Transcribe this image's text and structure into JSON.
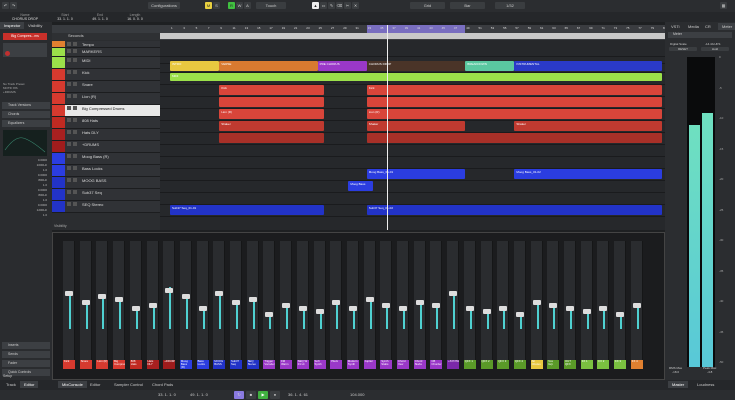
{
  "toolbar": {
    "configurations": "Configurations",
    "m": "M",
    "s": "S",
    "r": "R",
    "w": "W",
    "a": "A",
    "touch": "Touch",
    "grid": "Grid",
    "bar": "Bar",
    "quant": "1/32"
  },
  "infoline": {
    "fields": [
      {
        "label": "Name",
        "value": "CHORUS DROP"
      },
      {
        "label": "Start",
        "value": "33. 1. 1.  0"
      },
      {
        "label": "End",
        "value": "49. 1. 1.  0"
      },
      {
        "label": "Length",
        "value": "16. 0. 0.  0"
      }
    ]
  },
  "inspector": {
    "tabs": [
      "Inspector",
      "Visibility"
    ],
    "track_name": "Big Compres...ms",
    "routing": [
      "No Track Preset",
      "MOTIF 8IS",
      "+DRUMS"
    ],
    "sections": [
      "Track Versions",
      "Chords",
      "Equalizers",
      "Inserts",
      "Sends",
      "Fader",
      "Quick Controls"
    ],
    "eq_values": [
      "0.0000",
      "1000Hz",
      "1.0",
      "0.0000",
      "800Hz",
      "1.0",
      "0.0000",
      "800Hz",
      "1.0",
      "0.0000",
      "1200Hz",
      "1.0"
    ],
    "setup": "Setup"
  },
  "tracklist": {
    "header": "Seconds",
    "footer": "Visibility",
    "tracks": [
      {
        "name": "Tempo",
        "color": "#e08030"
      },
      {
        "name": "MARKERS",
        "color": "#9be04a"
      },
      {
        "name": "MIDI",
        "color": "#9be04a"
      },
      {
        "name": "Kick",
        "color": "#d63a2f"
      },
      {
        "name": "Snare",
        "color": "#d63a2f"
      },
      {
        "name": "Lion (R)",
        "color": "#d63a2f"
      },
      {
        "name": "Big Compressed Drums",
        "color": "#d63a2f",
        "selected": true
      },
      {
        "name": "808 Hats",
        "color": "#c02a22"
      },
      {
        "name": "Hats DLY",
        "color": "#a82020"
      },
      {
        "name": "+DRUMS",
        "color": "#a01c1c"
      },
      {
        "name": "Moog Bass (R)",
        "color": "#2b3de0"
      },
      {
        "name": "Bass Locks",
        "color": "#2b3de0"
      },
      {
        "name": "MOOG BASS",
        "color": "#2233c8"
      },
      {
        "name": "Sub37 Seq",
        "color": "#2233c8"
      },
      {
        "name": "SEQ Stereo",
        "color": "#2233c8"
      }
    ]
  },
  "ruler": {
    "bars": [
      "1",
      "3",
      "5",
      "7",
      "9",
      "11",
      "13",
      "15",
      "17",
      "19",
      "21",
      "23",
      "25",
      "27",
      "29",
      "31",
      "33",
      "35",
      "37",
      "39",
      "41",
      "43",
      "45",
      "47",
      "49",
      "51",
      "53",
      "55",
      "57",
      "59",
      "61",
      "63",
      "65",
      "67",
      "69",
      "71",
      "73",
      "75",
      "77",
      "79",
      "81"
    ]
  },
  "markers": [
    {
      "label": "INTRO",
      "start": 1,
      "end": 9,
      "color": "#e8c840"
    },
    {
      "label": "VERSE",
      "start": 9,
      "end": 25,
      "color": "#d87a30"
    },
    {
      "label": "PRE CHORUS",
      "start": 25,
      "end": 33,
      "color": "#9a38c8"
    },
    {
      "label": "CHORUS DROP",
      "start": 33,
      "end": 49,
      "color": "#4a3428"
    },
    {
      "label": "BREAKDOWN",
      "start": 49,
      "end": 57,
      "color": "#5ac8a0"
    },
    {
      "label": "INSTRUMENTAL",
      "start": 57,
      "end": 81,
      "color": "#2a3ac8"
    }
  ],
  "clips": [
    {
      "row": 2,
      "label": "MIDI",
      "start": 1,
      "end": 81,
      "color": "#9be04a"
    },
    {
      "row": 3,
      "label": "Kick",
      "start": 9,
      "end": 26,
      "color": "#d8453a"
    },
    {
      "row": 3,
      "label": "Kick",
      "start": 33,
      "end": 81,
      "color": "#d8453a"
    },
    {
      "row": 4,
      "label": "",
      "start": 9,
      "end": 26,
      "color": "#d8453a"
    },
    {
      "row": 4,
      "label": "",
      "start": 33,
      "end": 81,
      "color": "#d8453a"
    },
    {
      "row": 5,
      "label": "Lion (R)",
      "start": 9,
      "end": 26,
      "color": "#d8453a"
    },
    {
      "row": 5,
      "label": "Lion (R)",
      "start": 33,
      "end": 81,
      "color": "#d8453a"
    },
    {
      "row": 6,
      "label": "Shaker",
      "start": 9,
      "end": 26,
      "color": "#c03a30"
    },
    {
      "row": 6,
      "label": "Shaker",
      "start": 33,
      "end": 49,
      "color": "#c03a30"
    },
    {
      "row": 6,
      "label": "Shaker",
      "start": 57,
      "end": 81,
      "color": "#c03a30"
    },
    {
      "row": 7,
      "label": "",
      "start": 9,
      "end": 26,
      "color": "#a83028"
    },
    {
      "row": 7,
      "label": "",
      "start": 33,
      "end": 81,
      "color": "#a83028"
    },
    {
      "row": 10,
      "label": "Moog Bass_01-01",
      "start": 33,
      "end": 49,
      "color": "#2b3de0"
    },
    {
      "row": 10,
      "label": "Moog Bass_01-02",
      "start": 57,
      "end": 81,
      "color": "#2b3de0"
    },
    {
      "row": 11,
      "label": "Moog Bass",
      "start": 30,
      "end": 34,
      "color": "#2b3de0"
    },
    {
      "row": 13,
      "label": "Sub37 Seq_01-01",
      "start": 1,
      "end": 26,
      "color": "#2233c8"
    },
    {
      "row": 13,
      "label": "Sub37 Seq_01-02",
      "start": 33,
      "end": 81,
      "color": "#2233c8"
    }
  ],
  "mixer": {
    "channels": [
      {
        "name": "Kick",
        "color": "#d63a2f",
        "level": 0.55
      },
      {
        "name": "Snare",
        "color": "#d63a2f",
        "level": 0.4
      },
      {
        "name": "Lion (R)",
        "color": "#d63a2f",
        "level": 0.5
      },
      {
        "name": "Big Compresse",
        "color": "#d63a2f",
        "level": 0.45
      },
      {
        "name": "808 Hats",
        "color": "#c02a22",
        "level": 0.3
      },
      {
        "name": "Hats DLY",
        "color": "#a82020",
        "level": 0.35
      },
      {
        "name": "+DRUMS",
        "color": "#a01c1c",
        "level": 0.6
      },
      {
        "name": "Moog Bass (R)",
        "color": "#2b3de0",
        "level": 0.5
      },
      {
        "name": "Bass Locks",
        "color": "#2b3de0",
        "level": 0.3
      },
      {
        "name": "MOOG BASS",
        "color": "#2233c8",
        "level": 0.55
      },
      {
        "name": "Sub37 Seq",
        "color": "#2233c8",
        "level": 0.4
      },
      {
        "name": "SEQ Stereo",
        "color": "#2233c8",
        "level": 0.45
      },
      {
        "name": "Trigger Vocoder",
        "color": "#9a38c8",
        "level": 0.2
      },
      {
        "name": "FM Warm",
        "color": "#9a38c8",
        "level": 0.35
      },
      {
        "name": "SEQ W 01 Hi",
        "color": "#9a38c8",
        "level": 0.3
      },
      {
        "name": "Soft Synth",
        "color": "#9a38c8",
        "level": 0.25
      },
      {
        "name": "Pluck",
        "color": "#9a38c8",
        "level": 0.4
      },
      {
        "name": "Modern Synth",
        "color": "#9a38c8",
        "level": 0.3
      },
      {
        "name": "Jupiter",
        "color": "#9a38c8",
        "level": 0.45
      },
      {
        "name": "Synth Stabs",
        "color": "#9a38c8",
        "level": 0.35
      },
      {
        "name": "Chord Vew",
        "color": "#9a38c8",
        "level": 0.3
      },
      {
        "name": "Chord Stabs",
        "color": "#9a38c8",
        "level": 0.4
      },
      {
        "name": "CB Chorder",
        "color": "#9a38c8",
        "level": 0.35
      },
      {
        "name": "+SYNTHS",
        "color": "#7a28a8",
        "level": 0.55
      },
      {
        "name": "QFX 1",
        "color": "#5a9a28",
        "level": 0.3
      },
      {
        "name": "QFX 2",
        "color": "#5a9a28",
        "level": 0.25
      },
      {
        "name": "QFX 3",
        "color": "#5a9a28",
        "level": 0.3
      },
      {
        "name": "QFX 4",
        "color": "#5a9a28",
        "level": 0.2
      },
      {
        "name": "All Chorus",
        "color": "#e8c840",
        "level": 0.4
      },
      {
        "name": "Vox Grp",
        "color": "#5a9a28",
        "level": 0.35
      },
      {
        "name": "OUT QFX",
        "color": "#5a9a28",
        "level": 0.3
      },
      {
        "name": "FX 1",
        "color": "#7ac040",
        "level": 0.25
      },
      {
        "name": "FX 2",
        "color": "#7ac040",
        "level": 0.3
      },
      {
        "name": "FX 3",
        "color": "#7ac040",
        "level": 0.2
      },
      {
        "name": "FX 4",
        "color": "#e08030",
        "level": 0.35
      }
    ]
  },
  "right": {
    "tabs": [
      "VSTi",
      "Media",
      "CR",
      "Meter"
    ],
    "section": "Meter",
    "digital_scale": "Digital Scale",
    "digital_value": "-14.4/LUFS",
    "reset": "RESET",
    "hold": "Hold",
    "scale": [
      "0",
      "-5",
      "-10",
      "-15",
      "-20",
      "-25",
      "-30",
      "-35",
      "-40",
      "-45",
      "-50"
    ],
    "rms_label": "RMS Max",
    "peak_label": "Peak Max",
    "rms_value": "-18.0",
    "peak_value": "-4.8",
    "left_level": 0.78,
    "right_level": 0.82,
    "bottom_tabs": [
      "Master",
      "Loudness"
    ]
  },
  "bottom": {
    "left_tabs": [
      "Track",
      "Editor"
    ],
    "tabs": [
      "MixConsole",
      "Editor",
      "Sampler Control",
      "Chord Pads"
    ]
  },
  "transport": {
    "left_locator": "33. 1. 1.  0",
    "right_locator": "49. 1. 1.  0",
    "position": "36. 1. 4. 61",
    "tempo": "104.000"
  }
}
